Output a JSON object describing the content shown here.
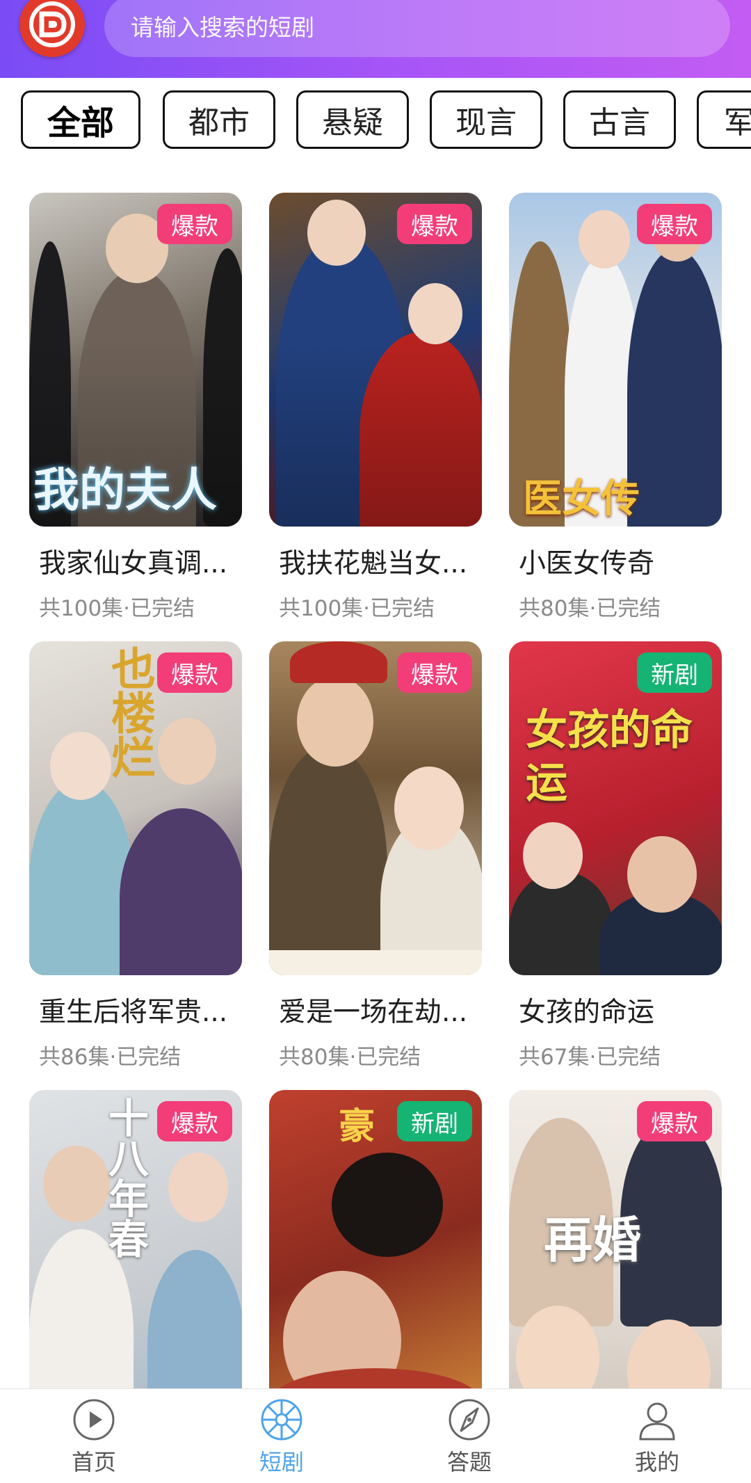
{
  "search": {
    "placeholder": "请输入搜索的短剧"
  },
  "tabs": [
    {
      "label": "全部",
      "active": true
    },
    {
      "label": "都市",
      "active": false
    },
    {
      "label": "悬疑",
      "active": false
    },
    {
      "label": "现言",
      "active": false
    },
    {
      "label": "古言",
      "active": false
    },
    {
      "label": "军",
      "active": false
    }
  ],
  "dramas": [
    {
      "title": "我家仙女真调...",
      "meta": "共100集·已完结",
      "badge": "爆款",
      "badge_type": "hot"
    },
    {
      "title": "我扶花魁当女...",
      "meta": "共100集·已完结",
      "badge": "爆款",
      "badge_type": "hot"
    },
    {
      "title": "小医女传奇",
      "meta": "共80集·已完结",
      "badge": "爆款",
      "badge_type": "hot"
    },
    {
      "title": "重生后将军贵...",
      "meta": "共86集·已完结",
      "badge": "爆款",
      "badge_type": "hot"
    },
    {
      "title": "爱是一场在劫...",
      "meta": "共80集·已完结",
      "badge": "爆款",
      "badge_type": "hot"
    },
    {
      "title": "女孩的命运",
      "meta": "共67集·已完结",
      "badge": "新剧",
      "badge_type": "new"
    },
    {
      "title": "",
      "meta": "",
      "badge": "爆款",
      "badge_type": "hot"
    },
    {
      "title": "",
      "meta": "",
      "badge": "新剧",
      "badge_type": "new"
    },
    {
      "title": "",
      "meta": "",
      "badge": "爆款",
      "badge_type": "hot"
    }
  ],
  "poster_text": [
    "我的夫人",
    "",
    "医女传",
    "也楼烂",
    "",
    "女孩的命运",
    "十八年春",
    "豪",
    "再婚"
  ],
  "nav": [
    {
      "label": "首页",
      "icon": "play-circle-icon",
      "active": false
    },
    {
      "label": "短剧",
      "icon": "wheel-icon",
      "active": true
    },
    {
      "label": "答题",
      "icon": "compass-icon",
      "active": false
    },
    {
      "label": "我的",
      "icon": "person-icon",
      "active": false
    }
  ],
  "colors": {
    "header_start": "#7a4cf5",
    "header_end": "#c35cf3",
    "badge_hot": "#f33d79",
    "badge_new": "#15b374",
    "nav_active": "#4ea3e8"
  }
}
